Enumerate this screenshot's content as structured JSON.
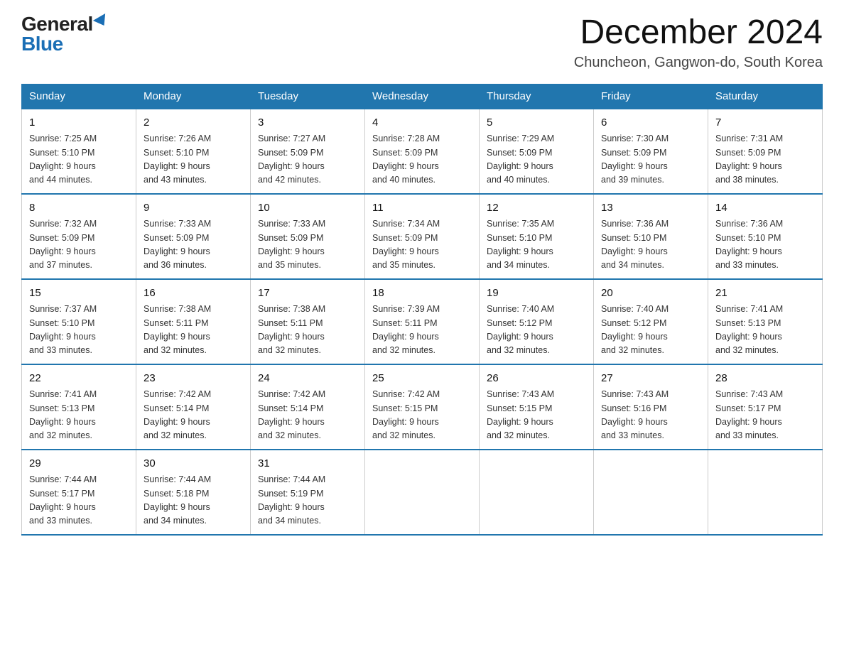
{
  "header": {
    "logo_general": "General",
    "logo_blue": "Blue",
    "month_title": "December 2024",
    "location": "Chuncheon, Gangwon-do, South Korea"
  },
  "days_of_week": [
    "Sunday",
    "Monday",
    "Tuesday",
    "Wednesday",
    "Thursday",
    "Friday",
    "Saturday"
  ],
  "weeks": [
    [
      {
        "day": "1",
        "sunrise": "7:25 AM",
        "sunset": "5:10 PM",
        "daylight": "9 hours and 44 minutes."
      },
      {
        "day": "2",
        "sunrise": "7:26 AM",
        "sunset": "5:10 PM",
        "daylight": "9 hours and 43 minutes."
      },
      {
        "day": "3",
        "sunrise": "7:27 AM",
        "sunset": "5:09 PM",
        "daylight": "9 hours and 42 minutes."
      },
      {
        "day": "4",
        "sunrise": "7:28 AM",
        "sunset": "5:09 PM",
        "daylight": "9 hours and 40 minutes."
      },
      {
        "day": "5",
        "sunrise": "7:29 AM",
        "sunset": "5:09 PM",
        "daylight": "9 hours and 40 minutes."
      },
      {
        "day": "6",
        "sunrise": "7:30 AM",
        "sunset": "5:09 PM",
        "daylight": "9 hours and 39 minutes."
      },
      {
        "day": "7",
        "sunrise": "7:31 AM",
        "sunset": "5:09 PM",
        "daylight": "9 hours and 38 minutes."
      }
    ],
    [
      {
        "day": "8",
        "sunrise": "7:32 AM",
        "sunset": "5:09 PM",
        "daylight": "9 hours and 37 minutes."
      },
      {
        "day": "9",
        "sunrise": "7:33 AM",
        "sunset": "5:09 PM",
        "daylight": "9 hours and 36 minutes."
      },
      {
        "day": "10",
        "sunrise": "7:33 AM",
        "sunset": "5:09 PM",
        "daylight": "9 hours and 35 minutes."
      },
      {
        "day": "11",
        "sunrise": "7:34 AM",
        "sunset": "5:09 PM",
        "daylight": "9 hours and 35 minutes."
      },
      {
        "day": "12",
        "sunrise": "7:35 AM",
        "sunset": "5:10 PM",
        "daylight": "9 hours and 34 minutes."
      },
      {
        "day": "13",
        "sunrise": "7:36 AM",
        "sunset": "5:10 PM",
        "daylight": "9 hours and 34 minutes."
      },
      {
        "day": "14",
        "sunrise": "7:36 AM",
        "sunset": "5:10 PM",
        "daylight": "9 hours and 33 minutes."
      }
    ],
    [
      {
        "day": "15",
        "sunrise": "7:37 AM",
        "sunset": "5:10 PM",
        "daylight": "9 hours and 33 minutes."
      },
      {
        "day": "16",
        "sunrise": "7:38 AM",
        "sunset": "5:11 PM",
        "daylight": "9 hours and 32 minutes."
      },
      {
        "day": "17",
        "sunrise": "7:38 AM",
        "sunset": "5:11 PM",
        "daylight": "9 hours and 32 minutes."
      },
      {
        "day": "18",
        "sunrise": "7:39 AM",
        "sunset": "5:11 PM",
        "daylight": "9 hours and 32 minutes."
      },
      {
        "day": "19",
        "sunrise": "7:40 AM",
        "sunset": "5:12 PM",
        "daylight": "9 hours and 32 minutes."
      },
      {
        "day": "20",
        "sunrise": "7:40 AM",
        "sunset": "5:12 PM",
        "daylight": "9 hours and 32 minutes."
      },
      {
        "day": "21",
        "sunrise": "7:41 AM",
        "sunset": "5:13 PM",
        "daylight": "9 hours and 32 minutes."
      }
    ],
    [
      {
        "day": "22",
        "sunrise": "7:41 AM",
        "sunset": "5:13 PM",
        "daylight": "9 hours and 32 minutes."
      },
      {
        "day": "23",
        "sunrise": "7:42 AM",
        "sunset": "5:14 PM",
        "daylight": "9 hours and 32 minutes."
      },
      {
        "day": "24",
        "sunrise": "7:42 AM",
        "sunset": "5:14 PM",
        "daylight": "9 hours and 32 minutes."
      },
      {
        "day": "25",
        "sunrise": "7:42 AM",
        "sunset": "5:15 PM",
        "daylight": "9 hours and 32 minutes."
      },
      {
        "day": "26",
        "sunrise": "7:43 AM",
        "sunset": "5:15 PM",
        "daylight": "9 hours and 32 minutes."
      },
      {
        "day": "27",
        "sunrise": "7:43 AM",
        "sunset": "5:16 PM",
        "daylight": "9 hours and 33 minutes."
      },
      {
        "day": "28",
        "sunrise": "7:43 AM",
        "sunset": "5:17 PM",
        "daylight": "9 hours and 33 minutes."
      }
    ],
    [
      {
        "day": "29",
        "sunrise": "7:44 AM",
        "sunset": "5:17 PM",
        "daylight": "9 hours and 33 minutes."
      },
      {
        "day": "30",
        "sunrise": "7:44 AM",
        "sunset": "5:18 PM",
        "daylight": "9 hours and 34 minutes."
      },
      {
        "day": "31",
        "sunrise": "7:44 AM",
        "sunset": "5:19 PM",
        "daylight": "9 hours and 34 minutes."
      },
      null,
      null,
      null,
      null
    ]
  ],
  "labels": {
    "sunrise": "Sunrise:",
    "sunset": "Sunset:",
    "daylight": "Daylight:"
  }
}
